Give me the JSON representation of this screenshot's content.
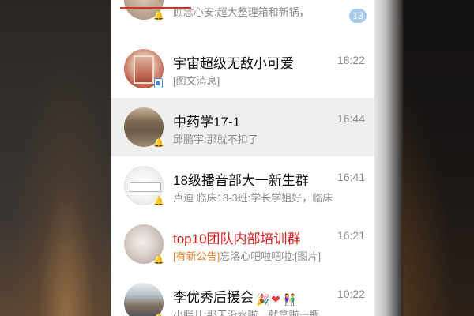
{
  "chats": [
    {
      "name": "",
      "preview": "顾念心安:超大整理箱和新锅，",
      "time": "",
      "unread": "13",
      "avatar": "ghost",
      "icon": "bell-icon"
    },
    {
      "name": "宇宙超级无敌小可爱",
      "preview": "[图文消息]",
      "time": "18:22",
      "avatar": "person-photo",
      "icon": "image-message-icon"
    },
    {
      "name": "中药学17-1",
      "preview": "邱鹏宇:那就不扣了",
      "time": "16:44",
      "avatar": "group-photo",
      "icon": "bell-icon",
      "selected": true
    },
    {
      "name": "18级播音部大一新生群",
      "preview": "卢迪   临床18-3班:学长学姐好，临床",
      "time": "16:41",
      "avatar": "logo-badge",
      "icon": "bell-icon"
    },
    {
      "name": "top10团队内部培训群",
      "preview_tag": "[有新公告]",
      "preview": "忘洛心吧啦吧啦:[图片]",
      "time": "16:21",
      "avatar": "cat-photo",
      "icon": "bell-icon",
      "name_color": "#d81e1e"
    },
    {
      "name": "李优秀后援会",
      "emojis": [
        "party-popper",
        "heart",
        "couple"
      ],
      "preview": "小胖儿:那天没水啦，就拿啦一瓶",
      "time": "10:22",
      "avatar": "crowd-photo",
      "icon": "bell-icon"
    }
  ],
  "colors": {
    "accent": "#c0392b",
    "tag": "#e67e22",
    "unread_badge": "#a9cbe8",
    "selected_row": "#efefef"
  }
}
